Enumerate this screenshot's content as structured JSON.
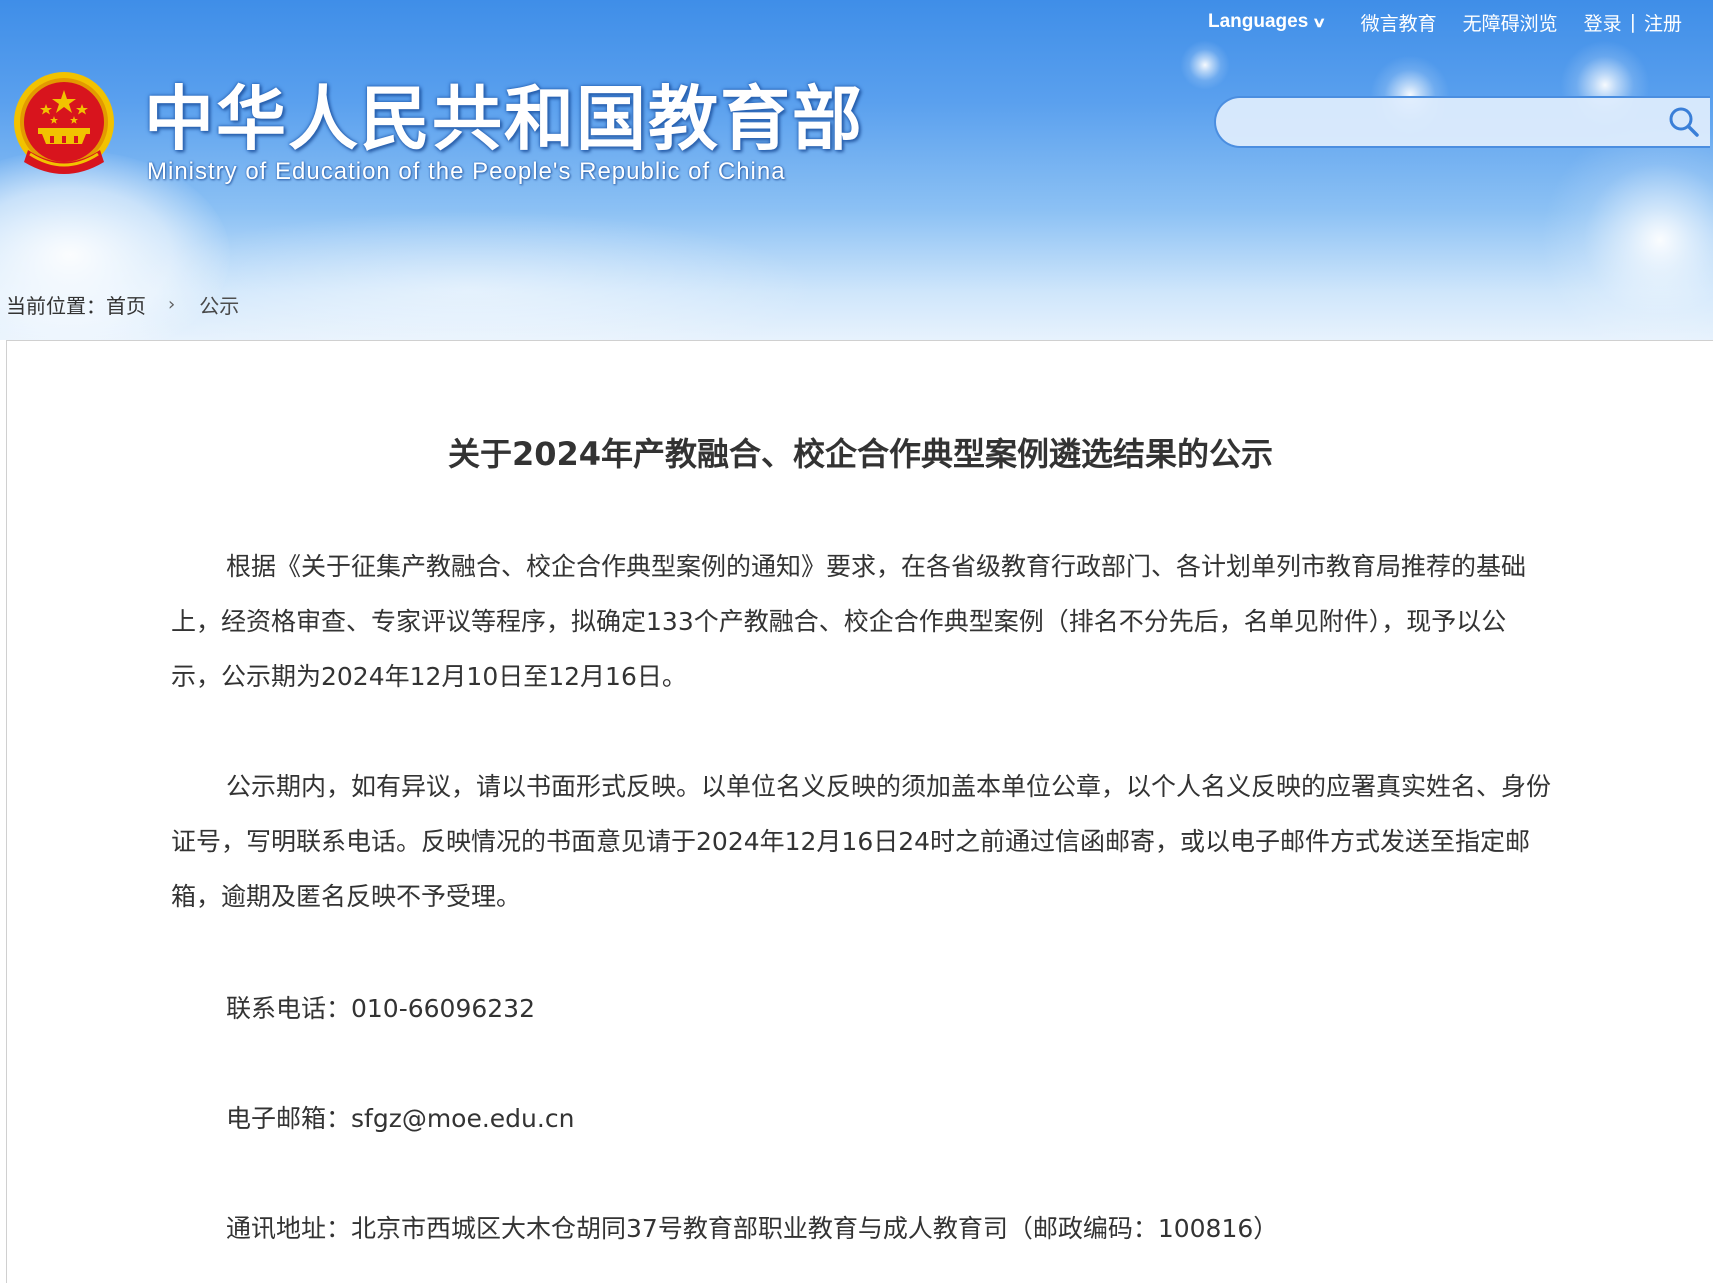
{
  "topnav": {
    "languages": "Languages",
    "wechat_edu": "微言教育",
    "accessible": "无障碍浏览",
    "login": "登录",
    "separator": "|",
    "register": "注册"
  },
  "site": {
    "title_cn": "中华人民共和国教育部",
    "title_en": "Ministry of Education of the People's Republic of China"
  },
  "search": {
    "placeholder": "",
    "value": ""
  },
  "breadcrumb": {
    "label": "当前位置：",
    "home": "首页",
    "current": "公示"
  },
  "article": {
    "title": "关于2024年产教融合、校企合作典型案例遴选结果的公示",
    "paragraphs": [
      "根据《关于征集产教融合、校企合作典型案例的通知》要求，在各省级教育行政部门、各计划单列市教育局推荐的基础上，经资格审查、专家评议等程序，拟确定133个产教融合、校企合作典型案例（排名不分先后，名单见附件），现予以公示，公示期为2024年12月10日至12月16日。",
      "公示期内，如有异议，请以书面形式反映。以单位名义反映的须加盖本单位公章，以个人名义反映的应署真实姓名、身份证号，写明联系电话。反映情况的书面意见请于2024年12月16日24时之前通过信函邮寄，或以电子邮件方式发送至指定邮箱，逾期及匿名反映不予受理。"
    ],
    "contact_phone": "联系电话：010-66096232",
    "contact_email": "电子邮箱：sfgz@moe.edu.cn",
    "contact_address": "通讯地址：北京市西城区大木仓胡同37号教育部职业教育与成人教育司（邮政编码：100816）"
  },
  "colors": {
    "header_top": "#3f8ee8",
    "header_bottom": "#e7f2fd",
    "body_text": "#333333",
    "search_border": "#4b8ee0",
    "emblem_red": "#d8141d",
    "emblem_gold": "#f2c200"
  },
  "icons": {
    "emblem": "national-emblem-icon",
    "search": "search-icon",
    "chevron": "chevron-down-icon",
    "breadcrumb_arrow": "chevron-right-icon"
  }
}
